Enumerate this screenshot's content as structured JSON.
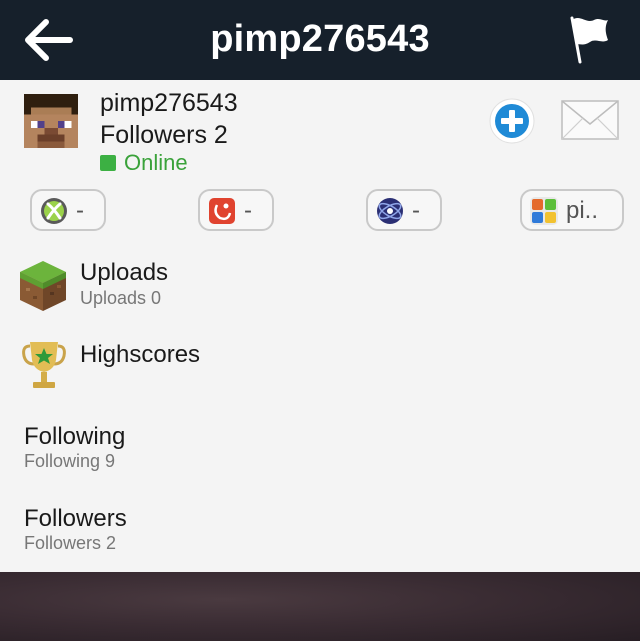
{
  "navbar": {
    "title": "pimp276543",
    "back_icon": "back-arrow-icon",
    "flag_icon": "flag-icon",
    "background": "#16202b"
  },
  "profile": {
    "username": "pimp276543",
    "followers_label": "Followers 2",
    "status": "Online",
    "status_color": "#3aa23a",
    "avatar_icon": "minecraft-steve-avatar",
    "add_icon": "add-friend-icon",
    "mail_icon": "mail-envelope-icon"
  },
  "gamer_tags": [
    {
      "platform_icon": "xbox-icon",
      "value": "-"
    },
    {
      "platform_icon": "game-center-icon",
      "value": "-"
    },
    {
      "platform_icon": "playstation-network-icon",
      "value": "-"
    },
    {
      "platform_icon": "game-center-apps-icon",
      "value": "pi.."
    }
  ],
  "menu": {
    "uploads": {
      "title": "Uploads",
      "subtitle": "Uploads 0",
      "icon": "grass-block-icon"
    },
    "highscores": {
      "title": "Highscores",
      "icon": "trophy-icon"
    },
    "following": {
      "title": "Following",
      "subtitle": "Following 9"
    },
    "followers": {
      "title": "Followers",
      "subtitle": "Followers 2"
    }
  }
}
